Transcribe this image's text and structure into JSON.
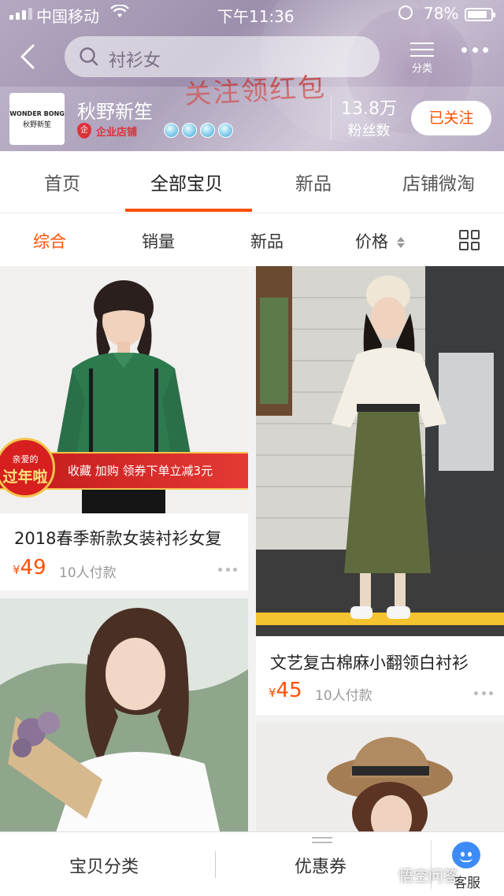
{
  "status_bar": {
    "carrier": "中国移动",
    "time": "下午11:36",
    "battery": "78%"
  },
  "nav": {
    "search_placeholder": "衬衫女",
    "category_label": "分类"
  },
  "promo_text": "关注领红包",
  "shop": {
    "logo_en": "WONDER BONG",
    "logo_cn": "秋野新笙",
    "name": "秋野新笙",
    "badge": "企业店铺",
    "fans_count": "13.8万",
    "fans_label": "粉丝数",
    "follow_label": "已关注"
  },
  "tabs": [
    "首页",
    "全部宝贝",
    "新品",
    "店铺微淘"
  ],
  "active_tab": 1,
  "sorts": [
    "综合",
    "销量",
    "新品",
    "价格"
  ],
  "products": [
    {
      "title": "2018春季新款女装衬衫女复",
      "currency": "¥",
      "price": "49",
      "paid": "10人付款",
      "ribbon": {
        "medal_small": "亲爱的",
        "medal_big": "过年啦",
        "text": "收藏  加购  领券下单立减3元"
      }
    },
    {
      "title": "文艺复古棉麻小翻领白衬衫",
      "currency": "¥",
      "price": "45",
      "paid": "10人付款"
    }
  ],
  "bottom_bar": {
    "category": "宝贝分类",
    "coupon": "优惠券",
    "service": "客服"
  },
  "watermark": "悟空问答",
  "colors": {
    "accent": "#ff5000",
    "header": "#a79ab7"
  }
}
